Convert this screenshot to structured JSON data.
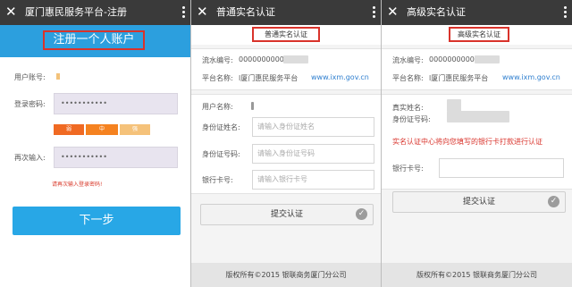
{
  "close_glyph": "✕",
  "screen1": {
    "title": "厦门惠民服务平台-注册",
    "heading": "注册一个人账户",
    "account_label": "用户账号:",
    "password_label": "登录密码:",
    "password_value": "•••••••••••",
    "strength": [
      "弱",
      "中",
      "强"
    ],
    "confirm_label": "再次输入:",
    "confirm_value": "•••••••••••",
    "error_text": "请再次输入登录密码!",
    "next_button": "下一步",
    "colors": {
      "header_blue": "#2c9fde",
      "weak": "#f06a23",
      "medium": "#f58220",
      "strong": "#f5c27a"
    }
  },
  "screen2": {
    "title": "普通实名认证",
    "tag": "普通实名认证",
    "serial_label": "流水编号:",
    "serial_value": "0000000000",
    "platform_label": "平台名称:",
    "platform_value": "l厦门惠民服务平台",
    "platform_link": "www.ixm.gov.cn",
    "username_label": "用户名称:",
    "idname_label": "身份证姓名:",
    "idname_placeholder": "请输入身份证姓名",
    "idnum_label": "身份证号码:",
    "idnum_placeholder": "请输入身份证号码",
    "bank_label": "银行卡号:",
    "bank_placeholder": "请输入银行卡号",
    "submit_button": "提交认证",
    "footer": "版权所有©2015 银联商务厦门分公司"
  },
  "screen3": {
    "title": "高级实名认证",
    "tag": "高级实名认证",
    "serial_label": "流水编号:",
    "serial_value": "0000000000",
    "platform_label": "平台名称:",
    "platform_value": "l厦门惠民服务平台",
    "platform_link": "www.ixm.gov.cn",
    "realname_label": "真实姓名:",
    "idnum_label": "身份证号码:",
    "notice": "实名认证中心将向您填写的银行卡打款进行认证",
    "bank_label": "银行卡号:",
    "submit_button": "提交认证",
    "footer": "版权所有©2015 银联商务厦门分公司"
  }
}
